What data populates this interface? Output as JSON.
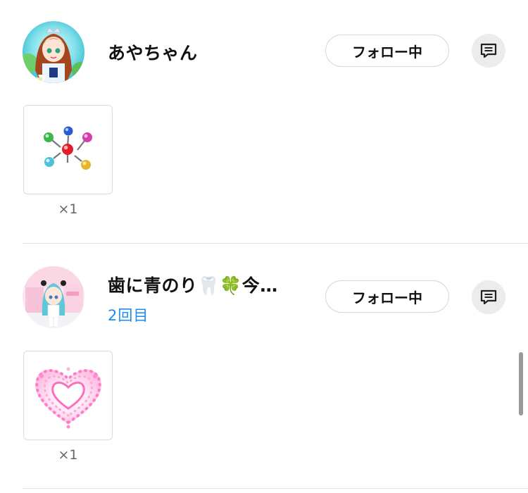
{
  "entries": [
    {
      "username": "あやちゃん",
      "visit_count": "",
      "follow_label": "フォロー中",
      "avatar_icon": "anime-girl-avatar",
      "gift": {
        "icon": "lollipops-gift-icon",
        "quantity": "×1"
      }
    },
    {
      "username": "歯に青のり🦷🍀今…",
      "visit_count": "2回目",
      "follow_label": "フォロー中",
      "avatar_icon": "anime-girl-teal-hair-avatar",
      "gift": {
        "icon": "pink-heart-gift-icon",
        "quantity": "×1"
      }
    }
  ],
  "colors": {
    "accent_blue": "#1a8cf5",
    "button_border": "#d6d6d6",
    "message_button_bg": "#ececec",
    "divider": "#e3e3e3"
  }
}
